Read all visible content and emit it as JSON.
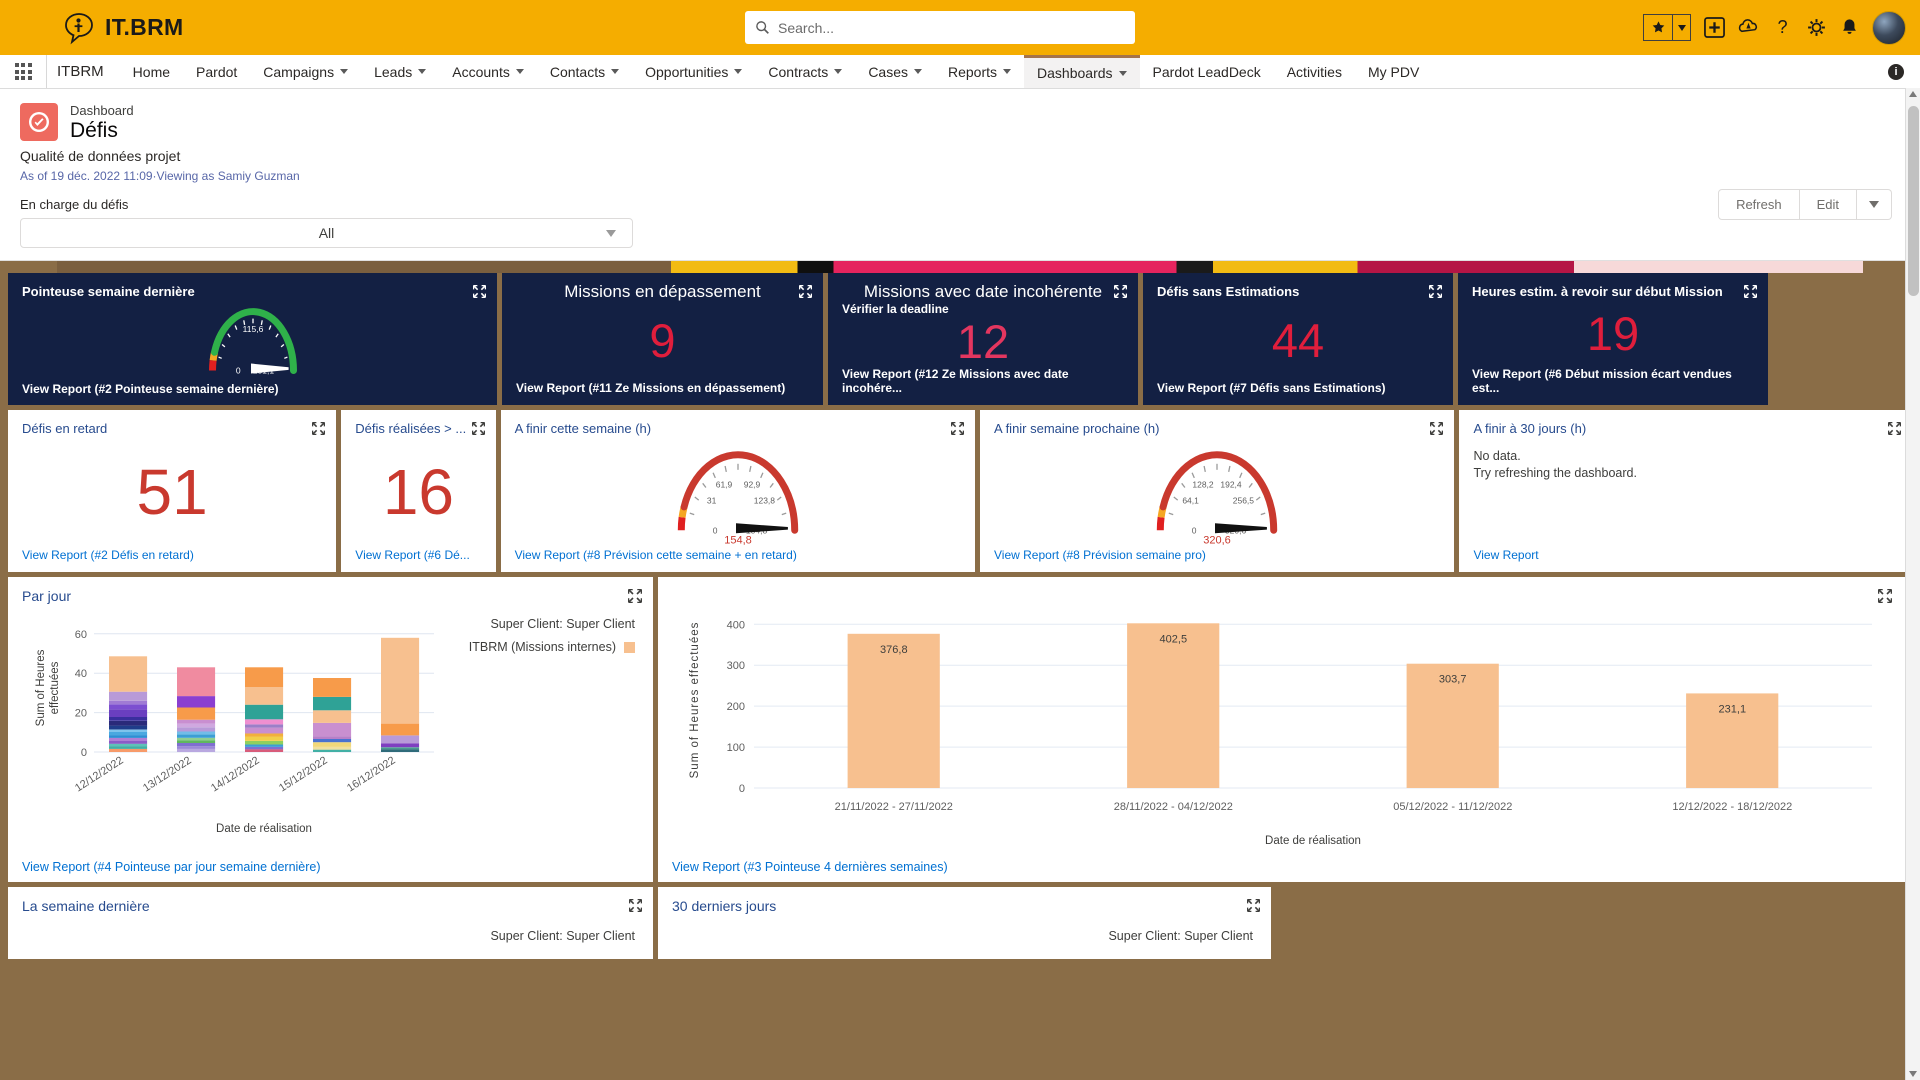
{
  "topbar": {
    "logo_text": "IT.BRM",
    "logo_icon": "speech-bubble-person-icon",
    "search_placeholder": "Search...",
    "icons": [
      "favorites-star-icon",
      "favorites-chevron-icon",
      "add-icon",
      "cloud-setup-icon",
      "help-icon",
      "settings-gear-icon",
      "notifications-bell-icon",
      "user-avatar"
    ]
  },
  "nav": {
    "app_name": "ITBRM",
    "items": [
      {
        "label": "Home",
        "dropdown": false
      },
      {
        "label": "Pardot",
        "dropdown": false
      },
      {
        "label": "Campaigns",
        "dropdown": true
      },
      {
        "label": "Leads",
        "dropdown": true
      },
      {
        "label": "Accounts",
        "dropdown": true
      },
      {
        "label": "Contacts",
        "dropdown": true
      },
      {
        "label": "Opportunities",
        "dropdown": true
      },
      {
        "label": "Contracts",
        "dropdown": true
      },
      {
        "label": "Cases",
        "dropdown": true
      },
      {
        "label": "Reports",
        "dropdown": true
      },
      {
        "label": "Dashboards",
        "dropdown": true,
        "active": true
      },
      {
        "label": "Pardot LeadDeck",
        "dropdown": false
      },
      {
        "label": "Activities",
        "dropdown": false
      },
      {
        "label": "My PDV",
        "dropdown": false
      }
    ],
    "info_icon": "info-icon"
  },
  "dashboard": {
    "kind": "Dashboard",
    "name": "Défis",
    "subtitle": "Qualité de données projet",
    "as_of": "As of 19 déc. 2022 11:09·Viewing as Samiy Guzman",
    "filter_label": "En charge du défis",
    "filter_value": "All",
    "refresh_label": "Refresh",
    "edit_label": "Edit"
  },
  "row1": [
    {
      "title": "Pointeuse semaine dernière",
      "type": "gauge",
      "link": "View Report (#2 Pointeuse semaine dernière)",
      "gauge": {
        "min": "0",
        "max": "231,1",
        "mid": "115,6",
        "value": 231.1,
        "color": "#2fb14a"
      }
    },
    {
      "title": "Missions en dépassement",
      "type": "metric",
      "value": "9",
      "link": "View Report (#11 Ze Missions en dépassement)"
    },
    {
      "title": "Missions avec date incohérente",
      "subtitle": "Vérifier la deadline",
      "type": "metric",
      "value": "12",
      "link": "View Report (#12 Ze Missions avec date incohére..."
    },
    {
      "title": "Défis sans Estimations",
      "type": "metric",
      "value": "44",
      "link": "View Report (#7 Défis sans Estimations)"
    },
    {
      "title": "Heures estim. à revoir sur début Mission",
      "type": "metric",
      "value": "19",
      "link": "View Report (#6 Début mission écart vendues est..."
    }
  ],
  "row2": [
    {
      "title": "Défis en retard",
      "type": "metric",
      "value": "51",
      "link": "View Report (#2 Défis en retard)"
    },
    {
      "title": "Défis réalisées > ...",
      "type": "metric",
      "value": "16",
      "link": "View Report (#6 Dé..."
    },
    {
      "title": "A finir cette semaine (h)",
      "type": "gauge",
      "link": "View Report (#8 Prévision cette semaine + en retard)",
      "gauge": {
        "min": "0",
        "t1": "31",
        "t2": "61,9",
        "t3": "92,9",
        "t4": "123,8",
        "max": "154,8",
        "value_label": "154,8",
        "color": "#c9392e"
      }
    },
    {
      "title": "A finir semaine prochaine (h)",
      "type": "gauge",
      "link": "View Report (#8 Prévision semaine pro)",
      "gauge": {
        "min": "0",
        "t1": "64,1",
        "t2": "128,2",
        "t3": "192,4",
        "t4": "256,5",
        "max": "320,6",
        "value_label": "320,6",
        "color": "#c9392e"
      }
    },
    {
      "title": "A finir à 30 jours (h)",
      "type": "nodata",
      "nodata_line1": "No data.",
      "nodata_line2": "Try refreshing the dashboard.",
      "link": "View Report"
    }
  ],
  "chart_data": [
    {
      "type": "bar",
      "card_title": "Par jour",
      "stacked": true,
      "title": "",
      "xlabel": "Date de réalisation",
      "ylabel": "Sum of Heures effectuées",
      "ylim": [
        0,
        65
      ],
      "yticks": [
        0,
        20,
        40,
        60
      ],
      "grid": true,
      "legend_title": "Super Client: Super Client",
      "legend": [
        {
          "name": "ITBRM (Missions internes)",
          "color": "#f7c08f"
        }
      ],
      "legend_position": "right",
      "categories": [
        "12/12/2022",
        "13/12/2022",
        "14/12/2022",
        "15/12/2022",
        "16/12/2022"
      ],
      "totals": [
        50.2,
        45.0,
        43.0,
        37.6,
        58.0
      ],
      "segments": [
        [
          {
            "color": "#f79b6a",
            "value": 1.6
          },
          {
            "color": "#42b0a5",
            "value": 1.4
          },
          {
            "color": "#5ec2b8",
            "value": 1.2
          },
          {
            "color": "#8b5cc7",
            "value": 1.4
          },
          {
            "color": "#b07fd6",
            "value": 1.6
          },
          {
            "color": "#2e8fd4",
            "value": 1.4
          },
          {
            "color": "#4aa8e0",
            "value": 1.6
          },
          {
            "color": "#7fc4ec",
            "value": 1.2
          },
          {
            "color": "#1f3d8a",
            "value": 2.0
          },
          {
            "color": "#2a2a7a",
            "value": 2.4
          },
          {
            "color": "#3a2f9e",
            "value": 2.0
          },
          {
            "color": "#6a3fc0",
            "value": 3.8
          },
          {
            "color": "#7c4fd0",
            "value": 2.6
          },
          {
            "color": "#a07bd4",
            "value": 1.8
          },
          {
            "color": "#b89ad8",
            "value": 4.6
          },
          {
            "color": "#f7c08f",
            "value": 18.0
          }
        ],
        [
          {
            "color": "#b9a8e0",
            "value": 1.6
          },
          {
            "color": "#9b88d8",
            "value": 1.4
          },
          {
            "color": "#7f6fd0",
            "value": 1.6
          },
          {
            "color": "#5fb85f",
            "value": 1.4
          },
          {
            "color": "#8fd08f",
            "value": 1.2
          },
          {
            "color": "#3c9fd4",
            "value": 1.8
          },
          {
            "color": "#72bde8",
            "value": 1.4
          },
          {
            "color": "#b89ad8",
            "value": 2.2
          },
          {
            "color": "#d0a8e0",
            "value": 1.8
          },
          {
            "color": "#c98fd0",
            "value": 2.0
          },
          {
            "color": "#f79b4a",
            "value": 6.2
          },
          {
            "color": "#8b3fd0",
            "value": 5.8
          },
          {
            "color": "#f08ba0",
            "value": 14.6
          }
        ],
        [
          {
            "color": "#d85c7a",
            "value": 1.4
          },
          {
            "color": "#7f6fd0",
            "value": 1.2
          },
          {
            "color": "#3c9fd4",
            "value": 1.2
          },
          {
            "color": "#8fd05f",
            "value": 1.8
          },
          {
            "color": "#f2cf4a",
            "value": 2.2
          },
          {
            "color": "#f2b03c",
            "value": 1.6
          },
          {
            "color": "#c98fd0",
            "value": 3.0
          },
          {
            "color": "#9b7fc8",
            "value": 1.6
          },
          {
            "color": "#ef8fd0",
            "value": 2.6
          },
          {
            "color": "#2fa296",
            "value": 7.4
          },
          {
            "color": "#f7c08f",
            "value": 9.0
          },
          {
            "color": "#f79b4a",
            "value": 10.0
          }
        ],
        [
          {
            "color": "#42b0a5",
            "value": 1.2
          },
          {
            "color": "#f2e0a0",
            "value": 1.4
          },
          {
            "color": "#f2d87a",
            "value": 2.4
          },
          {
            "color": "#4a72d0",
            "value": 1.6
          },
          {
            "color": "#b87fc8",
            "value": 1.4
          },
          {
            "color": "#c98fd0",
            "value": 6.8
          },
          {
            "color": "#f7c08f",
            "value": 6.4
          },
          {
            "color": "#2fa296",
            "value": 6.8
          },
          {
            "color": "#f79b4a",
            "value": 9.6
          }
        ],
        [
          {
            "color": "#2f6b7a",
            "value": 1.4
          },
          {
            "color": "#4a9b8f",
            "value": 1.0
          },
          {
            "color": "#7f3fc0",
            "value": 2.0
          },
          {
            "color": "#b89ad8",
            "value": 4.0
          },
          {
            "color": "#f79b4a",
            "value": 6.0
          },
          {
            "color": "#f7c08f",
            "value": 43.6
          }
        ]
      ],
      "link": "View Report (#4 Pointeuse par jour semaine dernière)"
    },
    {
      "type": "bar",
      "card_title": "",
      "stacked": false,
      "xlabel": "Date de réalisation",
      "ylabel": "Sum of Heures effectuées",
      "ylim": [
        0,
        430
      ],
      "yticks": [
        0,
        100,
        200,
        300,
        400
      ],
      "grid": true,
      "color": "#f7c08f",
      "categories": [
        "21/11/2022 - 27/11/2022",
        "28/11/2022 - 04/12/2022",
        "05/12/2022 - 11/12/2022",
        "12/12/2022 - 18/12/2022"
      ],
      "values": [
        376.8,
        402.5,
        303.7,
        231.1
      ],
      "value_labels": [
        "376,8",
        "402,5",
        "303,7",
        "231,1"
      ],
      "link": "View Report (#3 Pointeuse 4 dernières semaines)"
    }
  ],
  "row4": [
    {
      "title": "La semaine dernière",
      "legend_title": "Super Client: Super Client"
    },
    {
      "title": "30 derniers jours",
      "legend_title": "Super Client: Super Client"
    }
  ],
  "colors": {
    "brand_orange": "#f5ad00",
    "dark_card": "#132043",
    "metric_red": "#c9392e",
    "link_blue": "#0070d2",
    "gauge_green": "#2fb14a",
    "gauge_red": "#c9392e",
    "bar_peach": "#f7c08f"
  }
}
